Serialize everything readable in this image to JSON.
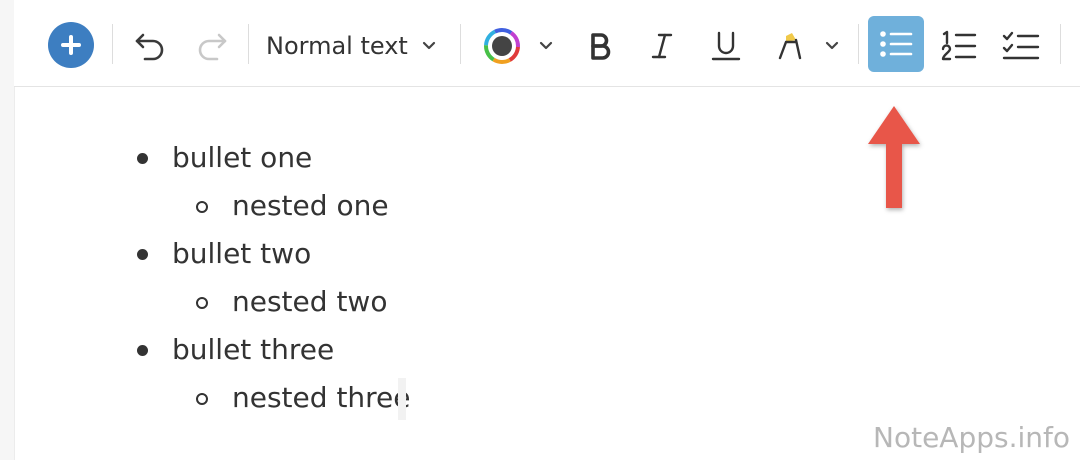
{
  "toolbar": {
    "text_style": "Normal text",
    "icons": [
      "plus-icon",
      "undo-icon",
      "redo-icon",
      "chevron-down-icon",
      "color-wheel-icon",
      "bold-icon",
      "italic-icon",
      "underline-icon",
      "highlighter-icon",
      "bulleted-list-icon",
      "numbered-list-icon",
      "checklist-icon"
    ],
    "active_tool": "bulleted-list",
    "colors": {
      "accent": "#3d7ec1",
      "active_bg": "#6fb0db",
      "highlight": "#f0c94a",
      "arrow": "#e8574a"
    }
  },
  "editor": {
    "items": [
      {
        "text": "bullet one",
        "level": 1
      },
      {
        "text": "nested one",
        "level": 2
      },
      {
        "text": "bullet two",
        "level": 1
      },
      {
        "text": "nested two",
        "level": 2
      },
      {
        "text": "bullet three",
        "level": 1
      },
      {
        "text": "nested three",
        "level": 2
      }
    ]
  },
  "watermark": "NoteApps.info"
}
